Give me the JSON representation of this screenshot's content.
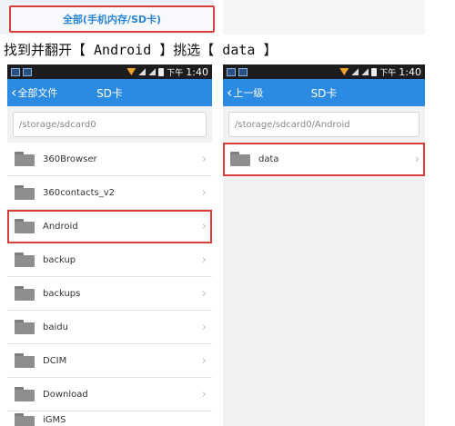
{
  "top_banner": {
    "tab_label": "全部(手机内存/SD卡)"
  },
  "instruction": "找到并翻开【 Android 】挑选【 data 】",
  "statusbar": {
    "pm": "下午",
    "time": "1:40"
  },
  "left_screen": {
    "back_label": "全部文件",
    "title": "SD卡",
    "path": "/storage/sdcard0",
    "items": [
      {
        "name": "360Browser"
      },
      {
        "name": "360contacts_v2"
      },
      {
        "name": "Android"
      },
      {
        "name": "backup"
      },
      {
        "name": "backups"
      },
      {
        "name": "baidu"
      },
      {
        "name": "DCIM"
      },
      {
        "name": "Download"
      },
      {
        "name": "iGMS"
      }
    ]
  },
  "right_screen": {
    "back_label": "上一级",
    "title": "SD卡",
    "path": "/storage/sdcard0/Android",
    "items": [
      {
        "name": "data"
      }
    ]
  },
  "colors": {
    "accent": "#2b8ae1",
    "highlight": "#d9403a"
  }
}
